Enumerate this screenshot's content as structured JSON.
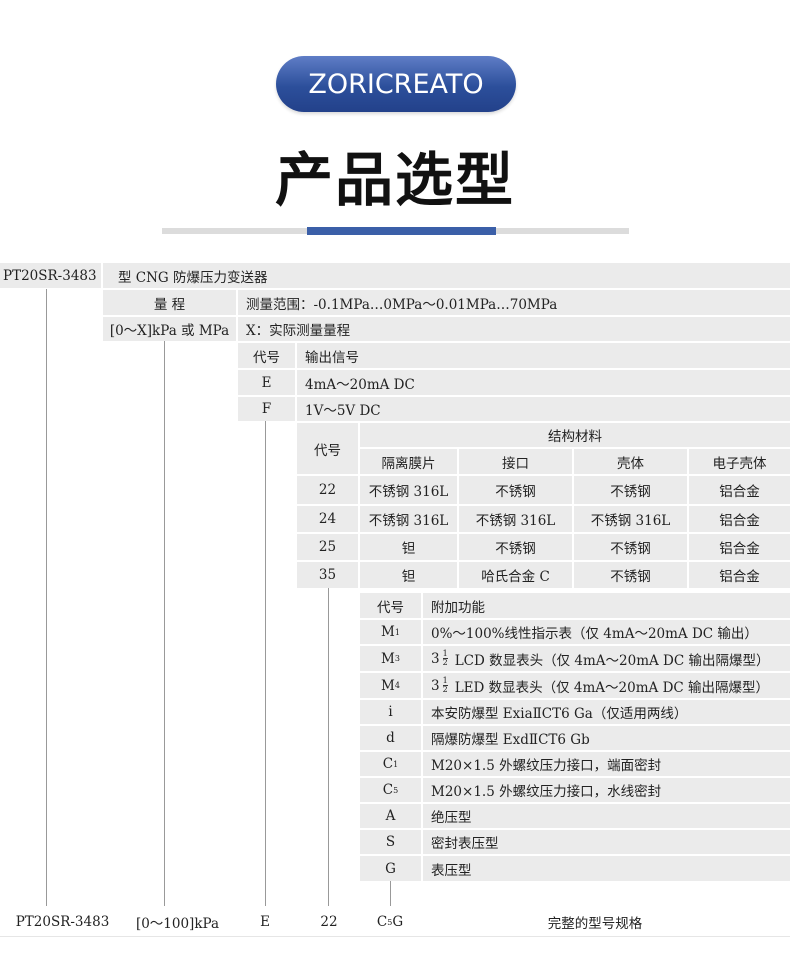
{
  "header": {
    "brand": "ZORICREATO",
    "title": "产品选型"
  },
  "row1": {
    "model": "PT20SR-3483",
    "desc": "型 CNG 防爆压力变送器"
  },
  "range": {
    "label": "量 程",
    "desc": "测量范围：-0.1MPa…0MPa～0.01MPa…70MPa",
    "code": "[0～X]kPa 或 MPa",
    "code_desc": "X：实际测量量程"
  },
  "output": {
    "code_header": "代号",
    "desc_header": "输出信号",
    "rows": [
      {
        "code": "E",
        "desc": "4mA～20mA DC"
      },
      {
        "code": "F",
        "desc": "1V～5V DC"
      }
    ]
  },
  "material": {
    "code_header": "代号",
    "group_header": "结构材料",
    "columns": [
      "隔离膜片",
      "接口",
      "壳体",
      "电子壳体"
    ],
    "rows": [
      {
        "code": "22",
        "cells": [
          "不锈钢 316L",
          "不锈钢",
          "不锈钢",
          "铝合金"
        ]
      },
      {
        "code": "24",
        "cells": [
          "不锈钢 316L",
          "不锈钢 316L",
          "不锈钢 316L",
          "铝合金"
        ]
      },
      {
        "code": "25",
        "cells": [
          "钽",
          "不锈钢",
          "不锈钢",
          "铝合金"
        ]
      },
      {
        "code": "35",
        "cells": [
          "钽",
          "哈氏合金 C",
          "不锈钢",
          "铝合金"
        ]
      }
    ]
  },
  "functions": {
    "code_header": "代号",
    "desc_header": "附加功能",
    "rows": [
      {
        "code_main": "M",
        "code_sub": "1",
        "desc": "0%～100%线性指示表（仅 4mA～20mA DC 输出）"
      },
      {
        "code_main": "M",
        "code_sub": "3",
        "frac_num": "1",
        "frac_den": "2",
        "prefix": "3",
        "desc": "LCD 数显表头（仅 4mA～20mA DC 输出隔爆型）"
      },
      {
        "code_main": "M",
        "code_sub": "4",
        "frac_num": "1",
        "frac_den": "2",
        "prefix": "3",
        "desc": "LED 数显表头（仅 4mA～20mA DC 输出隔爆型）"
      },
      {
        "code_main": "i",
        "code_sub": "",
        "desc": "本安防爆型 ExiaⅡCT6 Ga（仅适用两线）"
      },
      {
        "code_main": "d",
        "code_sub": "",
        "desc": "隔爆防爆型 ExdⅡCT6 Gb"
      },
      {
        "code_main": "C",
        "code_sub": "1",
        "desc": "M20×1.5 外螺纹压力接口，端面密封"
      },
      {
        "code_main": "C",
        "code_sub": "5",
        "desc": "M20×1.5 外螺纹压力接口，水线密封"
      },
      {
        "code_main": "A",
        "code_sub": "",
        "desc": "绝压型"
      },
      {
        "code_main": "S",
        "code_sub": "",
        "desc": "密封表压型"
      },
      {
        "code_main": "G",
        "code_sub": "",
        "desc": "表压型"
      }
    ]
  },
  "example": {
    "model": "PT20SR-3483",
    "range": "[0～100]kPa",
    "output": "E",
    "material": "22",
    "func_main": "C",
    "func_sub": "5",
    "func_tail": "G",
    "label": "完整的型号规格"
  }
}
